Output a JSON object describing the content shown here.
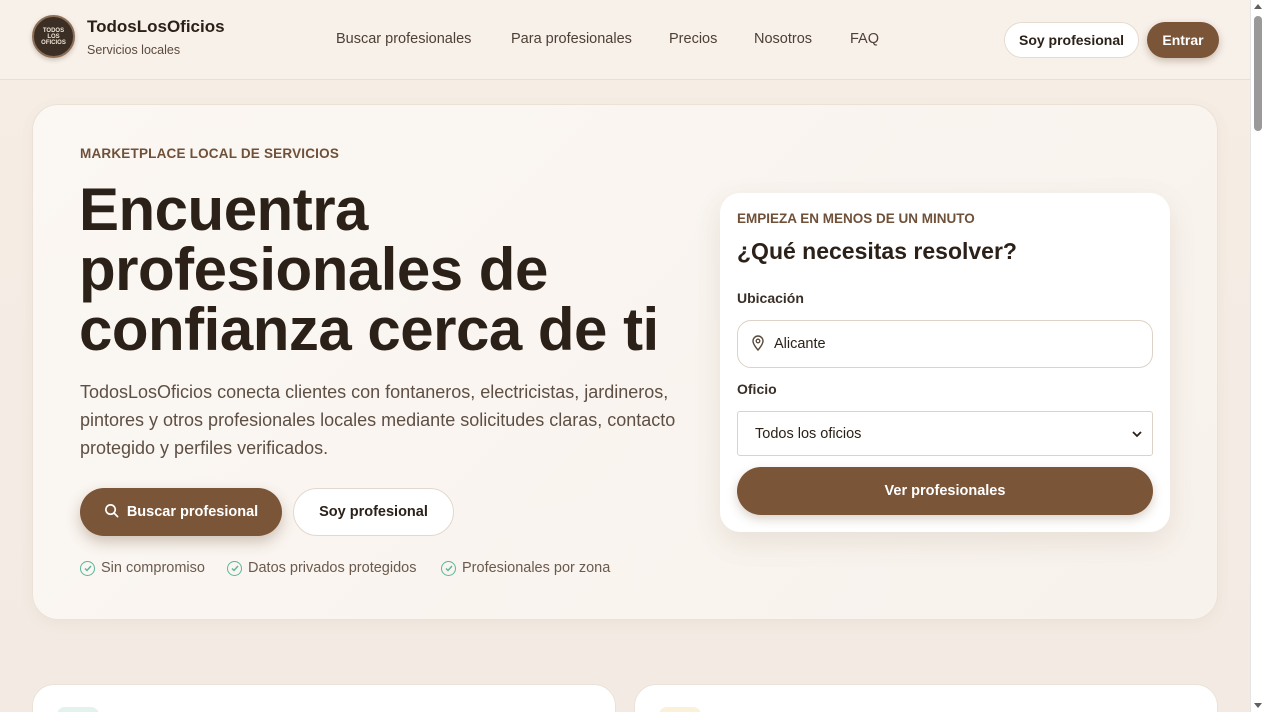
{
  "header": {
    "logo_text": "TODOS LOS OFICIOS",
    "brand_name": "TodosLosOficios",
    "brand_sub": "Servicios locales",
    "nav": [
      "Buscar profesionales",
      "Para profesionales",
      "Precios",
      "Nosotros",
      "FAQ"
    ],
    "pro_button": "Soy profesional",
    "login_button": "Entrar"
  },
  "hero": {
    "eyebrow": "MARKETPLACE LOCAL DE SERVICIOS",
    "title": "Encuentra profesionales de confianza cerca de ti",
    "description": "TodosLosOficios conecta clientes con fontaneros, electricistas, jardineros, pintores y otros profesionales locales mediante solicitudes claras, contacto protegido y perfiles verificados.",
    "primary_button": "Buscar profesional",
    "secondary_button": "Soy profesional",
    "features": [
      "Sin compromiso",
      "Datos privados protegidos",
      "Profesionales por zona"
    ]
  },
  "search": {
    "eyebrow": "EMPIEZA EN MENOS DE UN MINUTO",
    "title": "¿Qué necesitas resolver?",
    "location_label": "Ubicación",
    "location_value": "Alicante",
    "trade_label": "Oficio",
    "trade_selected": "Todos los oficios",
    "submit": "Ver profesionales"
  },
  "colors": {
    "accent": "#7b5538",
    "check": "#5ab59a"
  }
}
